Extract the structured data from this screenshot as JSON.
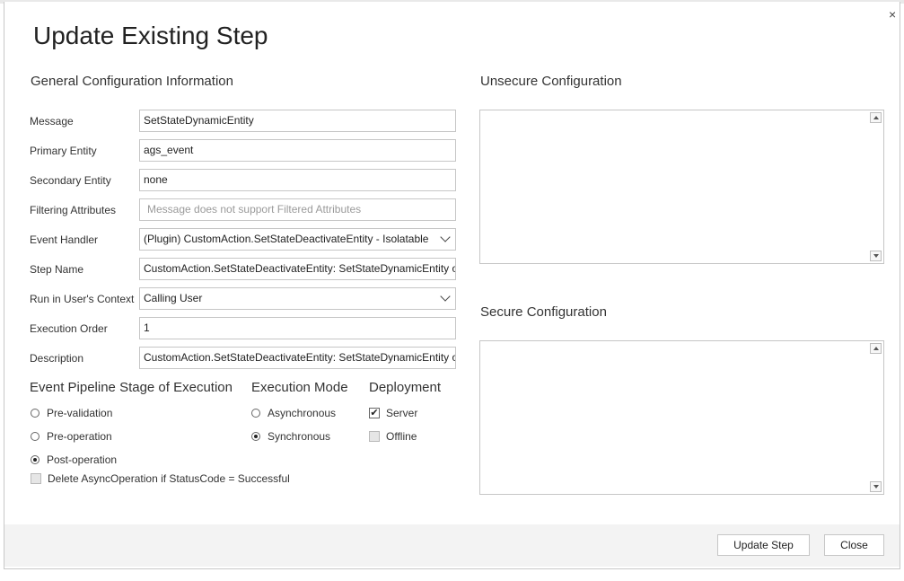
{
  "dialog": {
    "title": "Update Existing Step",
    "close_icon": "close-icon"
  },
  "general": {
    "title": "General Configuration Information",
    "fields": [
      {
        "label": "Message",
        "value": "SetStateDynamicEntity"
      },
      {
        "label": "Primary Entity",
        "value": "ags_event"
      },
      {
        "label": "Secondary Entity",
        "value": "none"
      },
      {
        "label": "Filtering Attributes",
        "placeholder": "Message does not support Filtered Attributes"
      },
      {
        "label": "Event Handler",
        "value": "(Plugin) CustomAction.SetStateDeactivateEntity - Isolatable"
      },
      {
        "label": "Step Name",
        "value": "CustomAction.SetStateDeactivateEntity: SetStateDynamicEntity of"
      },
      {
        "label": "Run in User's Context",
        "value": "Calling User"
      },
      {
        "label": "Execution Order",
        "value": "1"
      },
      {
        "label": "Description",
        "value": "CustomAction.SetStateDeactivateEntity: SetStateDynamicEntity of"
      }
    ]
  },
  "pipeline": {
    "title": "Event Pipeline Stage of Execution",
    "options": [
      "Pre-validation",
      "Pre-operation",
      "Post-operation"
    ],
    "selected": "Post-operation",
    "delete_async_label": "Delete AsyncOperation if StatusCode = Successful",
    "delete_async_checked": false
  },
  "execution_mode": {
    "title": "Execution Mode",
    "options": [
      "Asynchronous",
      "Synchronous"
    ],
    "selected": "Synchronous"
  },
  "deployment": {
    "title": "Deployment",
    "server_label": "Server",
    "server_checked": true,
    "offline_label": "Offline",
    "offline_checked": false
  },
  "unsecure": {
    "title": "Unsecure  Configuration",
    "value": ""
  },
  "secure": {
    "title": "Secure  Configuration",
    "value": ""
  },
  "footer": {
    "update_label": "Update Step",
    "close_label": "Close"
  }
}
